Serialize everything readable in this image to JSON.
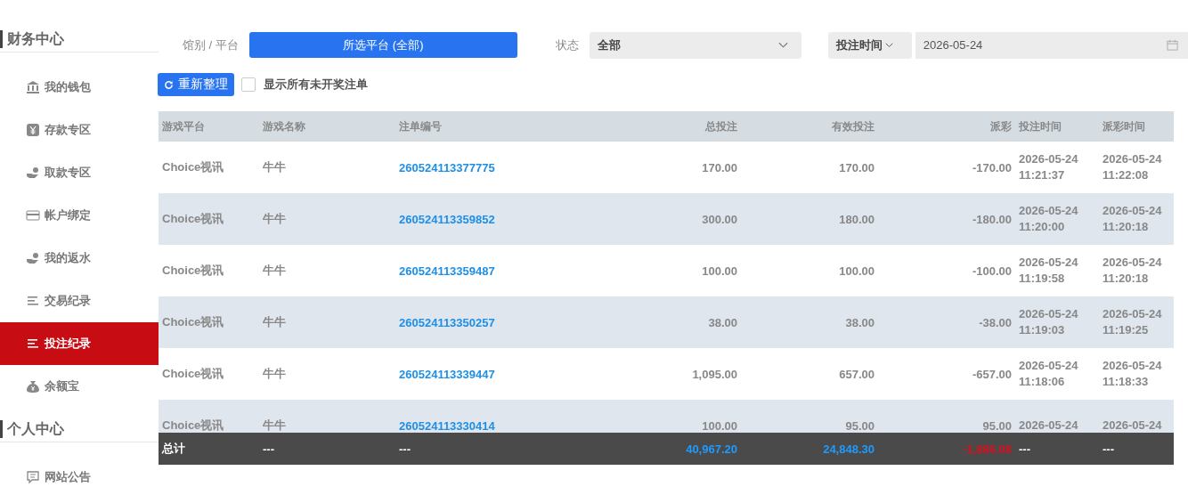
{
  "sidebar": {
    "sections": [
      {
        "title": "财务中心",
        "items": [
          {
            "label": "我的钱包",
            "kind": "bank",
            "selected": false
          },
          {
            "label": "存款专区",
            "kind": "yen",
            "selected": false
          },
          {
            "label": "取款专区",
            "kind": "hand",
            "selected": false
          },
          {
            "label": "帐户绑定",
            "kind": "card",
            "selected": false
          },
          {
            "label": "我的返水",
            "kind": "hand",
            "selected": false
          },
          {
            "label": "交易纪录",
            "kind": "list",
            "selected": false
          },
          {
            "label": "投注纪录",
            "kind": "list",
            "selected": true
          },
          {
            "label": "余额宝",
            "kind": "moneybag",
            "selected": false
          }
        ]
      },
      {
        "title": "个人中心",
        "items": [
          {
            "label": "网站公告",
            "kind": "chat",
            "selected": false
          }
        ]
      }
    ]
  },
  "filters": {
    "platform_label": "馆别 / 平台",
    "platform_button": "所选平台 (全部)",
    "status_label": "状态",
    "status_value": "全部",
    "time_type": "投注时间",
    "date_value": "2026-05-24"
  },
  "actions": {
    "refresh_button": "重新整理",
    "show_unsettled": {
      "label": "显示所有未开奖注单",
      "checked": false
    }
  },
  "table": {
    "columns": [
      "游戏平台",
      "游戏名称",
      "注单编号",
      "总投注",
      "有效投注",
      "派彩",
      "投注时间",
      "派彩时间"
    ],
    "rows": [
      {
        "platform": "Choice视讯",
        "game": "牛牛",
        "order_no": "260524113377775",
        "total_bet": "170.00",
        "valid_bet": "170.00",
        "payout": "-170.00",
        "bet_time": [
          "2026-05-24",
          "11:21:37"
        ],
        "payout_time": [
          "2026-05-24",
          "11:22:08"
        ]
      },
      {
        "platform": "Choice视讯",
        "game": "牛牛",
        "order_no": "260524113359852",
        "total_bet": "300.00",
        "valid_bet": "180.00",
        "payout": "-180.00",
        "bet_time": [
          "2026-05-24",
          "11:20:00"
        ],
        "payout_time": [
          "2026-05-24",
          "11:20:18"
        ]
      },
      {
        "platform": "Choice视讯",
        "game": "牛牛",
        "order_no": "260524113359487",
        "total_bet": "100.00",
        "valid_bet": "100.00",
        "payout": "-100.00",
        "bet_time": [
          "2026-05-24",
          "11:19:58"
        ],
        "payout_time": [
          "2026-05-24",
          "11:20:18"
        ]
      },
      {
        "platform": "Choice视讯",
        "game": "牛牛",
        "order_no": "260524113350257",
        "total_bet": "38.00",
        "valid_bet": "38.00",
        "payout": "-38.00",
        "bet_time": [
          "2026-05-24",
          "11:19:03"
        ],
        "payout_time": [
          "2026-05-24",
          "11:19:25"
        ]
      },
      {
        "platform": "Choice视讯",
        "game": "牛牛",
        "order_no": "260524113339447",
        "total_bet": "1,095.00",
        "valid_bet": "657.00",
        "payout": "-657.00",
        "bet_time": [
          "2026-05-24",
          "11:18:06"
        ],
        "payout_time": [
          "2026-05-24",
          "11:18:33"
        ]
      },
      {
        "platform": "Choice视讯",
        "game": "牛牛",
        "order_no": "260524113330414",
        "total_bet": "100.00",
        "valid_bet": "95.00",
        "payout": "95.00",
        "bet_time": [
          "2026-05-24"
        ],
        "payout_time": [
          "2026-05-24"
        ]
      }
    ],
    "footer": [
      {
        "text": "总计",
        "kind": "label"
      },
      {
        "text": "---",
        "kind": "blank"
      },
      {
        "text": "---",
        "kind": "blank"
      },
      {
        "text": "40,967.20",
        "kind": "bet"
      },
      {
        "text": "24,848.30",
        "kind": "bet"
      },
      {
        "text": "-1,886.08",
        "kind": "payout"
      },
      {
        "text": "---",
        "kind": "blank"
      },
      {
        "text": "---",
        "kind": "blank"
      }
    ]
  }
}
